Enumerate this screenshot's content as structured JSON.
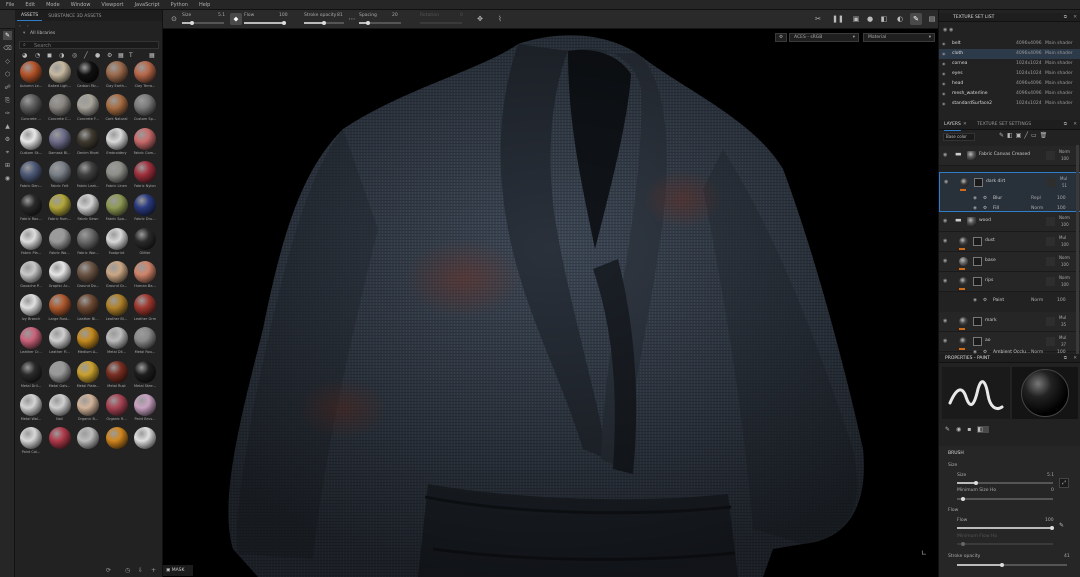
{
  "menu": [
    "File",
    "Edit",
    "Mode",
    "Window",
    "Viewport",
    "JavaScript",
    "Python",
    "Help"
  ],
  "toolbar": {
    "size_label": "Size",
    "size_value": "5.1",
    "flow_label": "Flow",
    "flow_value": "100",
    "stroke_opacity_label": "Stroke opacity",
    "stroke_opacity_value": "81",
    "spacing_label": "Spacing",
    "spacing_value": "20",
    "angle_label": "Rotation",
    "angle_value": "0"
  },
  "assets": {
    "tabs": [
      "ASSETS",
      "SUBSTANCE 3D ASSETS"
    ],
    "section": "All libraries",
    "search_placeholder": "Search",
    "items": [
      {
        "label": "Autumn Le...",
        "color": "#b5542a"
      },
      {
        "label": "Baked Ligh...",
        "color": "#c7b9a0"
      },
      {
        "label": "Carbon Fib...",
        "color": "#111111"
      },
      {
        "label": "Clay Earth...",
        "color": "#9c6b4c"
      },
      {
        "label": "Clay Terra...",
        "color": "#b8684a"
      },
      {
        "label": "Concrete ...",
        "color": "#5d5d5d"
      },
      {
        "label": "Concrete C...",
        "color": "#8a8782"
      },
      {
        "label": "Concrete F...",
        "color": "#a8a49b"
      },
      {
        "label": "Cork Natural",
        "color": "#a86e44"
      },
      {
        "label": "Custom Sp...",
        "color": "#7b7b7b"
      },
      {
        "label": "Custom Sk...",
        "color": "#e8e8e8"
      },
      {
        "label": "Damask Bl...",
        "color": "#6d6d8a"
      },
      {
        "label": "Denim Rivet",
        "color": "#3f3a30"
      },
      {
        "label": "Embroidery",
        "color": "#d9d9d9"
      },
      {
        "label": "Fabric Com...",
        "color": "#c96b6b"
      },
      {
        "label": "Fabric Den...",
        "color": "#4d5a78"
      },
      {
        "label": "Fabric Felt",
        "color": "#7a8088"
      },
      {
        "label": "Fabric Leat...",
        "color": "#404040"
      },
      {
        "label": "Fabric Linen",
        "color": "#8f8f8a"
      },
      {
        "label": "Fabric Nylon",
        "color": "#a0303d"
      },
      {
        "label": "Fabric Rou...",
        "color": "#2a2a2a"
      },
      {
        "label": "Fabric Rum...",
        "color": "#b2a63a"
      },
      {
        "label": "Fabric Sewn",
        "color": "#d2d2d2"
      },
      {
        "label": "Fabric Spa...",
        "color": "#8f9a55"
      },
      {
        "label": "Fabric Dru...",
        "color": "#2a3a80"
      },
      {
        "label": "Fabric Pla...",
        "color": "#dedede"
      },
      {
        "label": "Fabric Wo...",
        "color": "#9a9a9a"
      },
      {
        "label": "Fabric Wor...",
        "color": "#6a6a6a"
      },
      {
        "label": "Footprint",
        "color": "#d8d8d8"
      },
      {
        "label": "Glitter",
        "color": "#2a2a2a"
      },
      {
        "label": "Gouache P...",
        "color": "#c9c9c9"
      },
      {
        "label": "Graphic Ar...",
        "color": "#e6e6e6"
      },
      {
        "label": "Ground Do...",
        "color": "#6b5444"
      },
      {
        "label": "Ground Gr...",
        "color": "#cba784"
      },
      {
        "label": "Human Ba...",
        "color": "#d0846a"
      },
      {
        "label": "Ivy Branch",
        "color": "#e0e0e0"
      },
      {
        "label": "Large Rust...",
        "color": "#b05a2e"
      },
      {
        "label": "Leather Bi...",
        "color": "#6e4a34"
      },
      {
        "label": "Leather Bl...",
        "color": "#b0822a"
      },
      {
        "label": "Leather Grm",
        "color": "#a03830"
      },
      {
        "label": "Leather Cr...",
        "color": "#c9627a"
      },
      {
        "label": "Leather Fi...",
        "color": "#cfcfcf"
      },
      {
        "label": "Medium A...",
        "color": "#c58a1e"
      },
      {
        "label": "Metal Dil...",
        "color": "#bbbbbb"
      },
      {
        "label": "Metal Rou...",
        "color": "#8a8a8a"
      },
      {
        "label": "Metal Dril...",
        "color": "#2a2a2a"
      },
      {
        "label": "Metal Galv...",
        "color": "#999999"
      },
      {
        "label": "Metal Plate...",
        "color": "#caa12e"
      },
      {
        "label": "Metal Rust",
        "color": "#7a2e22"
      },
      {
        "label": "Metal Stee...",
        "color": "#1e1e1e"
      },
      {
        "label": "Metal Wal...",
        "color": "#d4d4d4"
      },
      {
        "label": "Nail",
        "color": "#cfcfcf"
      },
      {
        "label": "Organic B...",
        "color": "#d3b49a"
      },
      {
        "label": "Organic R...",
        "color": "#a84454"
      },
      {
        "label": "Paint Brus...",
        "color": "#c9a2c2"
      },
      {
        "label": "Paint Cal...",
        "color": "#d8d8d8"
      },
      {
        "label": "",
        "color": "#b03a4a"
      },
      {
        "label": "",
        "color": "#bdbdbd"
      },
      {
        "label": "",
        "color": "#d0861e"
      },
      {
        "label": "",
        "color": "#e0e0e0"
      }
    ]
  },
  "viewport": {
    "display_mode": "ACES - sRGB",
    "channel": "Material",
    "mask_label": "MASK"
  },
  "texture_set_list": {
    "title": "TEXTURE SET LIST",
    "rows": [
      {
        "name": "belt",
        "res": "4096x4096",
        "shader": "Main shader"
      },
      {
        "name": "cloth",
        "res": "4096x4096",
        "shader": "Main shader"
      },
      {
        "name": "cornea",
        "res": "1024x1024",
        "shader": "Main shader"
      },
      {
        "name": "eyes",
        "res": "1024x1024",
        "shader": "Main shader"
      },
      {
        "name": "head",
        "res": "4096x4096",
        "shader": "Main shader"
      },
      {
        "name": "mesh_waterline",
        "res": "4096x4096",
        "shader": "Main shader"
      },
      {
        "name": "standardSurface2",
        "res": "1024x1024",
        "shader": "Main shader"
      }
    ]
  },
  "layers": {
    "tab1": "LAYERS",
    "tab2": "TEXTURE SET SETTINGS",
    "base_color": "Base color",
    "rows": [
      {
        "name": "Fabric Canvas Creased",
        "blend": "Norm",
        "opacity": "100"
      },
      {
        "name": "dark dirt",
        "blend": "Mul",
        "opacity": "51"
      },
      {
        "name": "wood",
        "blend": "Norm",
        "opacity": "100"
      },
      {
        "name": "dust",
        "blend": "Mul",
        "opacity": "100"
      },
      {
        "name": "base",
        "blend": "Norm",
        "opacity": "100"
      },
      {
        "name": "rips",
        "blend": "Norm",
        "opacity": "100"
      },
      {
        "name": "mark",
        "blend": "Mul",
        "opacity": "35"
      },
      {
        "name": "ao",
        "blend": "Mul",
        "opacity": "37"
      }
    ],
    "subs": [
      {
        "name": "Blur",
        "blend": "Repl",
        "opacity": "100"
      },
      {
        "name": "Fill",
        "blend": "Norm",
        "opacity": "100"
      },
      {
        "name": "Paint",
        "blend": "Norm",
        "opacity": "100"
      },
      {
        "name": "Ambient Occlu...",
        "blend": "Norm",
        "opacity": "100"
      }
    ]
  },
  "properties": {
    "title": "PROPERTIES - PAINT",
    "brush_title": "BRUSH",
    "size_label": "Size",
    "size_value": "5.1",
    "min_size_label": "Minimum Size Ho",
    "min_size_value": "0",
    "flow_label": "Flow",
    "flow_sub_label": "Flow",
    "flow_value": "100",
    "min_flow_label": "Minimum Flow Ho",
    "stroke_opacity_label": "Stroke opacity",
    "stroke_opacity_value": "41"
  },
  "colors": {
    "accent": "#2f7dc9",
    "tag": "#d06b1a"
  }
}
